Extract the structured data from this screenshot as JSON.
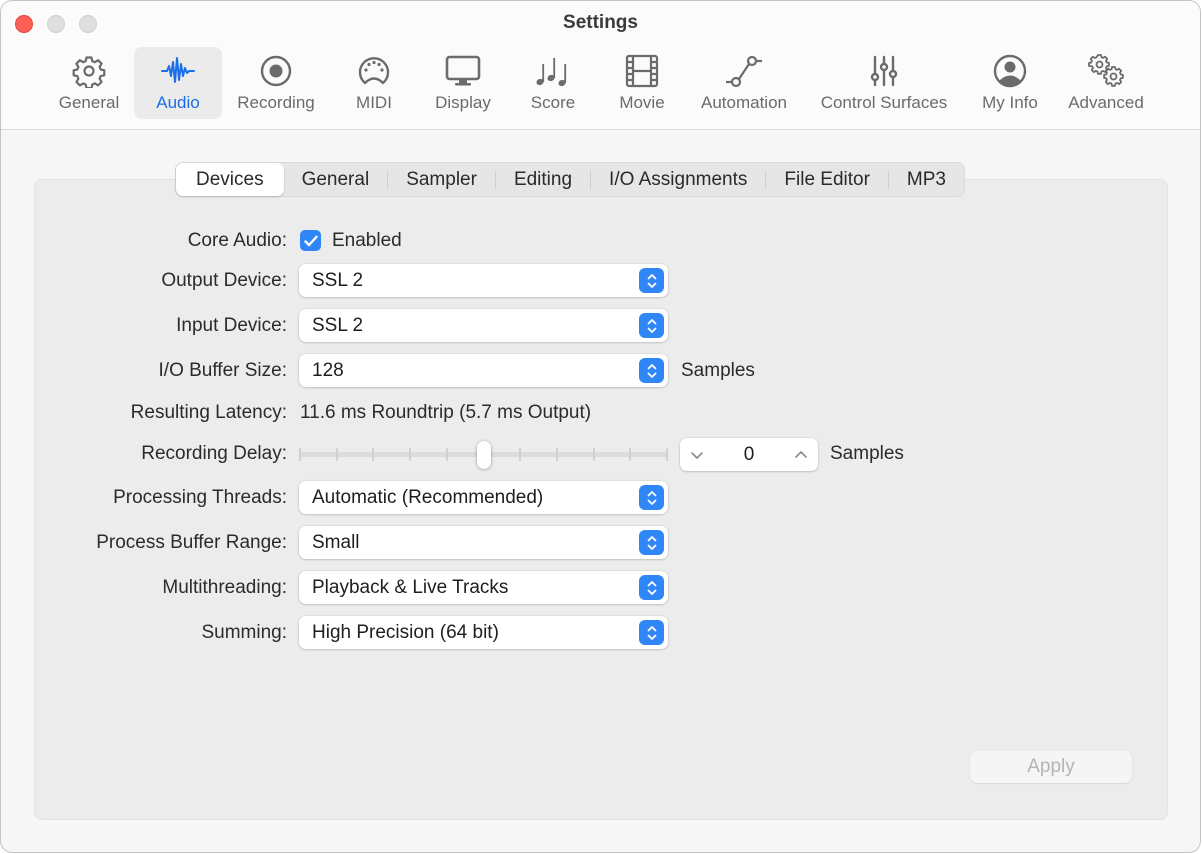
{
  "window": {
    "title": "Settings"
  },
  "toolbar": {
    "items": [
      {
        "label": "General",
        "icon": "gear-icon",
        "active": false
      },
      {
        "label": "Audio",
        "icon": "waveform-icon",
        "active": true
      },
      {
        "label": "Recording",
        "icon": "record-icon",
        "active": false
      },
      {
        "label": "MIDI",
        "icon": "midi-connector-icon",
        "active": false
      },
      {
        "label": "Display",
        "icon": "monitor-icon",
        "active": false
      },
      {
        "label": "Score",
        "icon": "music-notes-icon",
        "active": false
      },
      {
        "label": "Movie",
        "icon": "film-strip-icon",
        "active": false
      },
      {
        "label": "Automation",
        "icon": "automation-curve-icon",
        "active": false
      },
      {
        "label": "Control Surfaces",
        "icon": "sliders-icon",
        "active": false
      },
      {
        "label": "My Info",
        "icon": "person-circle-icon",
        "active": false
      },
      {
        "label": "Advanced",
        "icon": "gears-icon",
        "active": false
      }
    ]
  },
  "tabs": {
    "items": [
      {
        "label": "Devices",
        "active": true
      },
      {
        "label": "General",
        "active": false
      },
      {
        "label": "Sampler",
        "active": false
      },
      {
        "label": "Editing",
        "active": false
      },
      {
        "label": "I/O Assignments",
        "active": false
      },
      {
        "label": "File Editor",
        "active": false
      },
      {
        "label": "MP3",
        "active": false
      }
    ]
  },
  "devices": {
    "core_audio": {
      "label": "Core Audio:",
      "checkbox_label": "Enabled",
      "checked": true
    },
    "output_device": {
      "label": "Output Device:",
      "value": "SSL 2"
    },
    "input_device": {
      "label": "Input Device:",
      "value": "SSL 2"
    },
    "io_buffer_size": {
      "label": "I/O Buffer Size:",
      "value": "128",
      "unit": "Samples"
    },
    "resulting_latency": {
      "label": "Resulting Latency:",
      "value": "11.6 ms Roundtrip (5.7 ms Output)"
    },
    "recording_delay": {
      "label": "Recording Delay:",
      "value": "0",
      "unit": "Samples",
      "slider_position_fraction": 0.5,
      "tick_count": 11
    },
    "processing_threads": {
      "label": "Processing Threads:",
      "value": "Automatic (Recommended)"
    },
    "process_buffer_range": {
      "label": "Process Buffer Range:",
      "value": "Small"
    },
    "multithreading": {
      "label": "Multithreading:",
      "value": "Playback & Live Tracks"
    },
    "summing": {
      "label": "Summing:",
      "value": "High Precision (64 bit)"
    }
  },
  "footer": {
    "apply_label": "Apply",
    "apply_enabled": false
  },
  "colors": {
    "accent": "#2f86f6",
    "active_tab_text": "#1a6fe8",
    "close_button": "#fe5f57"
  }
}
